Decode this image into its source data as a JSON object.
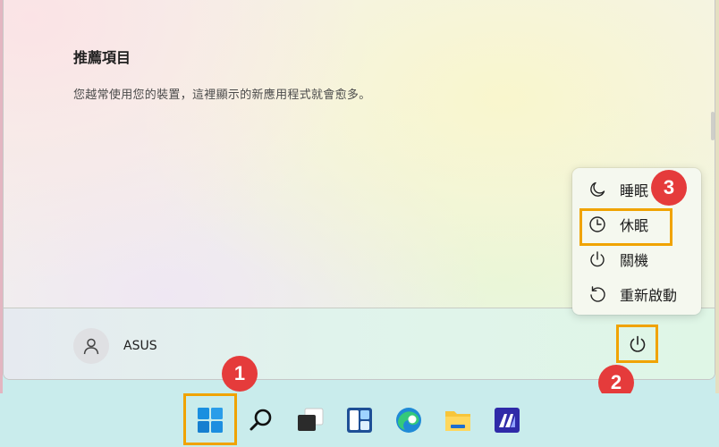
{
  "recommended": {
    "title": "推薦項目",
    "subtitle": "您越常使用您的裝置，這裡顯示的新應用程式就會愈多。"
  },
  "user": {
    "name": "ASUS"
  },
  "power_menu": {
    "items": [
      {
        "label": "睡眠",
        "icon": "moon-icon"
      },
      {
        "label": "休眠",
        "icon": "clock-icon"
      },
      {
        "label": "關機",
        "icon": "power-icon"
      },
      {
        "label": "重新啟動",
        "icon": "restart-icon"
      }
    ]
  },
  "badges": {
    "step1": "1",
    "step2": "2",
    "step3": "3"
  },
  "taskbar": {
    "icons": [
      "windows-start-icon",
      "search-icon",
      "task-view-icon",
      "widgets-icon",
      "edge-icon",
      "file-explorer-icon",
      "store-app-icon"
    ]
  },
  "colors": {
    "highlight": "#f0a300",
    "badge": "#e53b3b",
    "taskbar": "#c9ecec"
  }
}
